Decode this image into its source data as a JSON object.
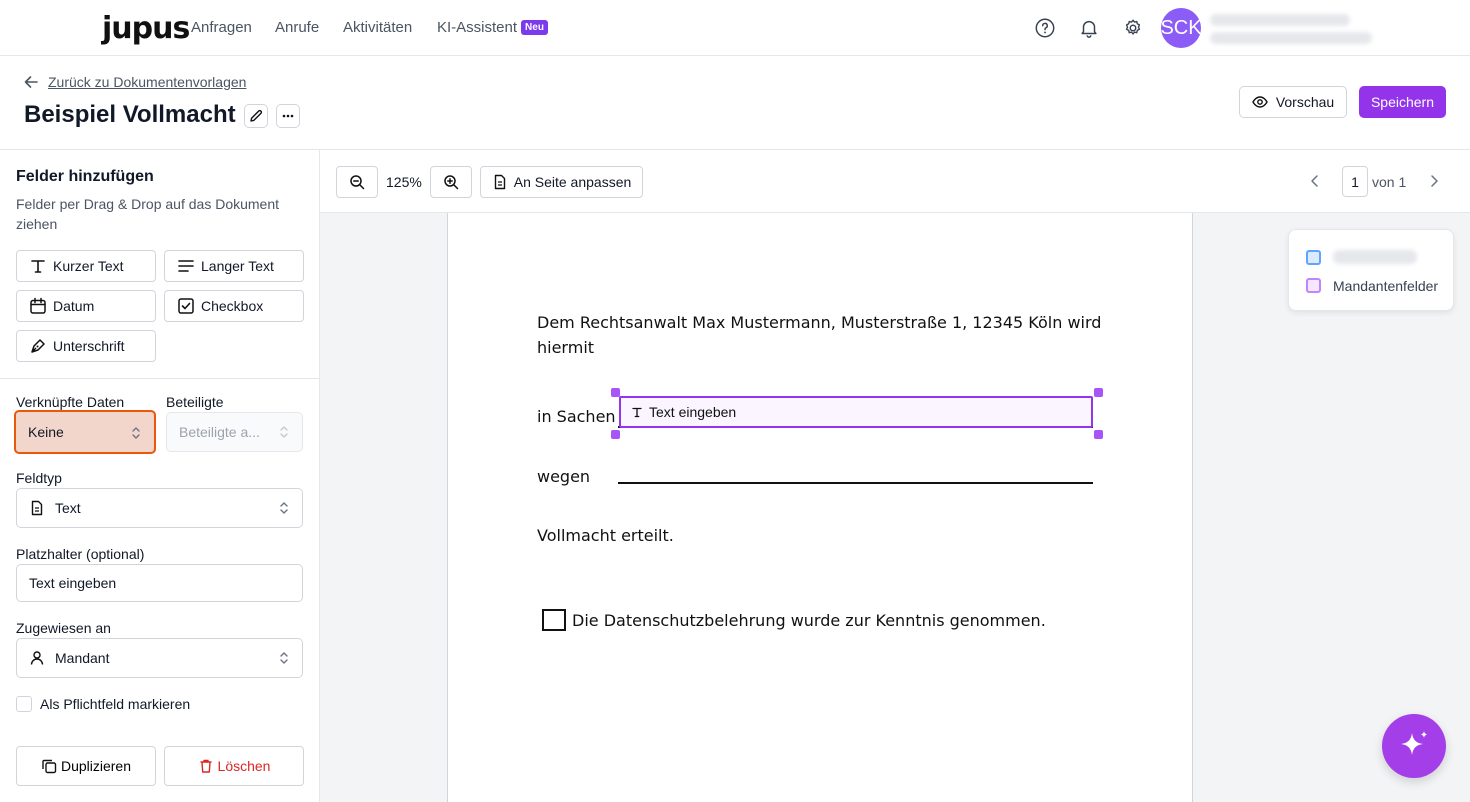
{
  "nav": {
    "logo": "jupus",
    "links": [
      "Anfragen",
      "Anrufe",
      "Aktivitäten",
      "KI-Assistent"
    ],
    "new_badge": "Neu",
    "avatar_initials": "SCK"
  },
  "header": {
    "back_label": "Zurück zu Dokumentenvorlagen",
    "title": "Beispiel Vollmacht",
    "preview_label": "Vorschau",
    "save_label": "Speichern"
  },
  "sidebar": {
    "title": "Felder hinzufügen",
    "subtitle": "Felder per Drag & Drop auf das Dokument ziehen",
    "field_types": [
      "Kurzer Text",
      "Langer Text",
      "Datum",
      "Checkbox",
      "Unterschrift"
    ],
    "linked_data_label": "Verknüpfte Daten",
    "linked_data_value": "Keine",
    "participants_label": "Beteiligte",
    "participants_placeholder": "Beteiligte a...",
    "field_type_label": "Feldtyp",
    "field_type_value": "Text",
    "placeholder_label": "Platzhalter (optional)",
    "placeholder_value": "Text eingeben",
    "assigned_label": "Zugewiesen an",
    "assigned_value": "Mandant",
    "required_label": "Als Pflichtfeld markieren",
    "duplicate_label": "Duplizieren",
    "delete_label": "Löschen"
  },
  "toolbar": {
    "zoom": "125%",
    "fit_label": "An Seite anpassen",
    "page_current": "1",
    "page_of": "von 1"
  },
  "document": {
    "line1": "Dem Rechtsanwalt Max Mustermann, Musterstraße 1, 12345 Köln wird",
    "line2": "hiermit",
    "in_sachen": "in Sachen",
    "field_placeholder": "Text eingeben",
    "wegen": "wegen",
    "vollmacht": "Vollmacht erteilt.",
    "checkbox_text": "Die Datenschutzbelehrung wurde zur Kenntnis genommen."
  },
  "legend": {
    "items": [
      "Mandantenfelder"
    ]
  },
  "colors": {
    "accent": "#9333ea",
    "highlight_border": "#ea580c",
    "delete": "#dc2626"
  }
}
